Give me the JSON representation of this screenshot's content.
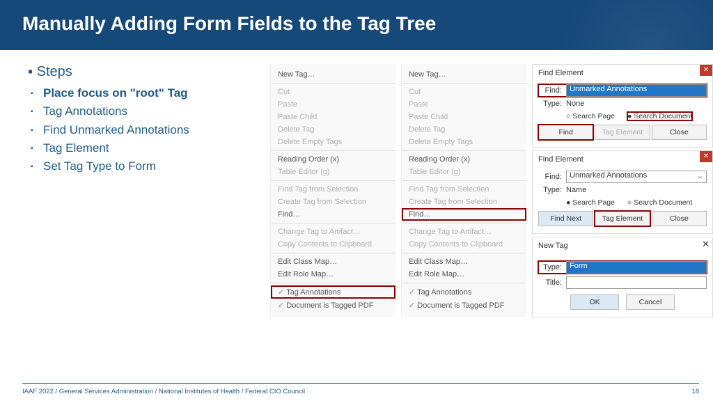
{
  "header": {
    "title": "Manually Adding Form Fields to the Tag Tree"
  },
  "steps": {
    "title": "Steps",
    "items": [
      {
        "label": "Place focus on \"root\" Tag",
        "bold": true
      },
      {
        "label": "Tag Annotations"
      },
      {
        "label": "Find Unmarked Annotations"
      },
      {
        "label": "Tag Element"
      },
      {
        "label": "Set Tag Type to Form"
      }
    ]
  },
  "menu": {
    "new_tag": "New Tag…",
    "cut": "Cut",
    "paste": "Paste",
    "paste_child": "Paste Child",
    "delete_tag": "Delete Tag",
    "delete_empty": "Delete Empty Tags",
    "reading_order": "Reading Order (x)",
    "table_editor": "Table Editor (g)",
    "find_sel": "Find Tag from Selection",
    "create_sel": "Create Tag from Selection",
    "find": "Find…",
    "change_artifact": "Change Tag to Artifact…",
    "copy_clip": "Copy Contents to Clipboard",
    "edit_class": "Edit Class Map…",
    "edit_role": "Edit Role Map…",
    "tag_ann": "Tag Annotations",
    "doc_tagged": "Document is Tagged PDF"
  },
  "dlg1": {
    "title": "Find Element",
    "find_label": "Find:",
    "find_value": "Unmarked Annotations",
    "type_label": "Type:",
    "type_value": "None",
    "radio1": "Search Page",
    "radio2": "Search Document",
    "btn_find": "Find",
    "btn_tag": "Tag Element",
    "btn_close": "Close"
  },
  "dlg2": {
    "title": "Find Element",
    "find_label": "Find:",
    "find_value": "Unmarked Annotations",
    "type_label": "Type:",
    "type_value": "Name",
    "radio1": "Search Page",
    "radio2": "Search Document",
    "btn_find": "Find Next",
    "btn_tag": "Tag Element",
    "btn_close": "Close"
  },
  "dlg3": {
    "title": "New Tag",
    "type_label": "Type:",
    "type_value": "Form",
    "title_label": "Title:",
    "btn_ok": "OK",
    "btn_cancel": "Cancel"
  },
  "footer": {
    "text": "IAAF 2022  /  General Services Administration  /  National Institutes of Health  /  Federal CIO Council",
    "page": "18"
  }
}
